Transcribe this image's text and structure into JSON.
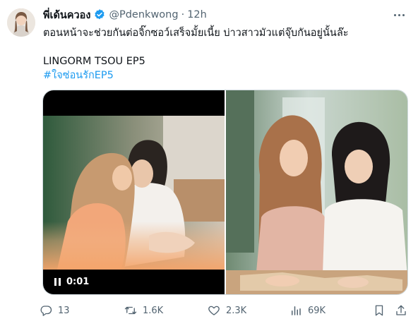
{
  "author": {
    "display_name": "พี่เด้นควอง",
    "handle": "@Pdenkwong",
    "separator": "·",
    "time": "12h",
    "verified": true,
    "verified_color": "#1d9bf0"
  },
  "tweet": {
    "line1": "ตอนหน้าจะช่วยกันต่อจิ๊กซอว์เสร็จมั้ยเนี้ย บ่าวสาวมัวแต่จุ๊บกันอยู่นั้นล๊ะ",
    "line2": "LINGORM TSOU EP5",
    "hashtag": "#ใจซ่อนรักEP5",
    "hashtag_color": "#1d9bf0"
  },
  "media": {
    "video": {
      "state": "playing",
      "control_icon": "pause-icon",
      "timestamp": "0:01"
    },
    "photo": {
      "icon": "image"
    }
  },
  "actions": {
    "reply": {
      "icon": "reply-icon",
      "count": "13"
    },
    "retweet": {
      "icon": "retweet-icon",
      "count": "1.6K"
    },
    "like": {
      "icon": "heart-icon",
      "count": "2.3K"
    },
    "views": {
      "icon": "views-icon",
      "count": "69K"
    },
    "bookmark": {
      "icon": "bookmark-icon"
    },
    "share": {
      "icon": "share-icon"
    }
  },
  "colors": {
    "text_primary": "#0f1419",
    "text_secondary": "#536471",
    "accent": "#1d9bf0",
    "border": "#cfd9de"
  }
}
